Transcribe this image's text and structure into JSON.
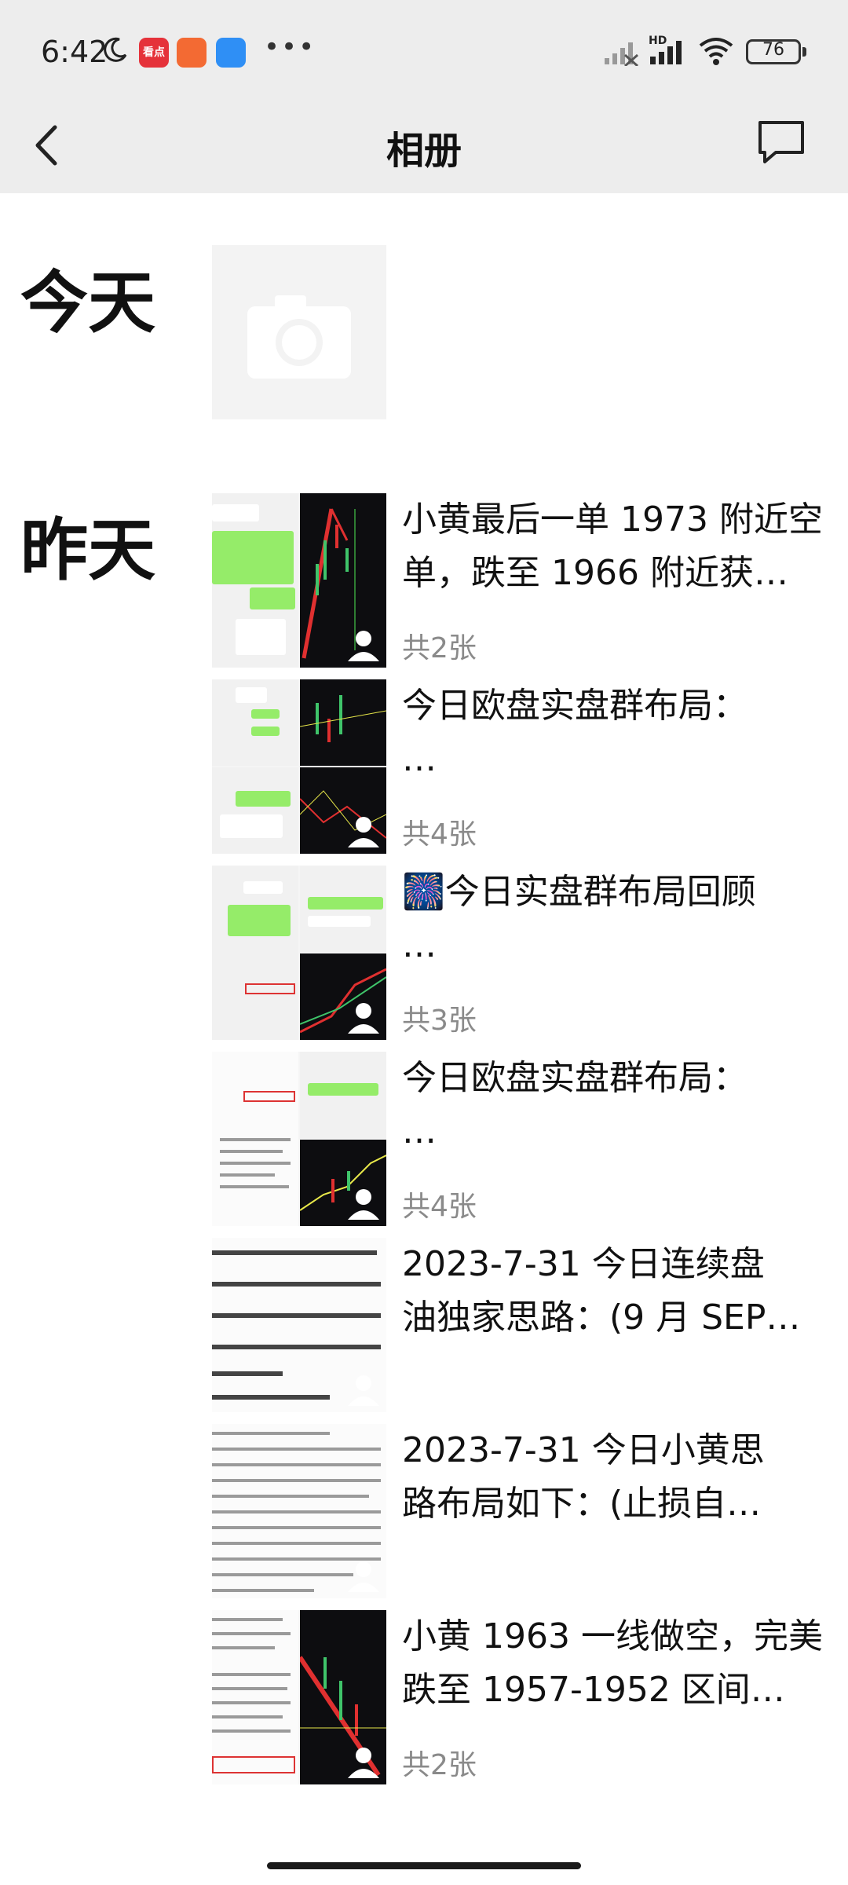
{
  "status_bar": {
    "time": "6:42",
    "battery": "76",
    "network": "HD",
    "app_badge_1": "看点"
  },
  "nav": {
    "title": "相册"
  },
  "sections": {
    "today": "今天",
    "yesterday": "昨天"
  },
  "albums": [
    {
      "line1": "小黄最后一单 1973 附近空",
      "line2": "单，跌至 1966 附近获…",
      "count": "共2张"
    },
    {
      "line1": "今日欧盘实盘群布局：",
      "line2": "…",
      "count": "共4张"
    },
    {
      "line1": "🎆今日实盘群布局回顾",
      "line2": "…",
      "count": "共3张"
    },
    {
      "line1": "今日欧盘实盘群布局：",
      "line2": "…",
      "count": "共4张"
    },
    {
      "line1": "2023-7-31  今日连续盘",
      "line2": "油独家思路：(9 月 SEP…",
      "count": ""
    },
    {
      "line1": "2023-7-31   今日小黄思",
      "line2": "路布局如下：(止损自…",
      "count": ""
    },
    {
      "line1": "小黄 1963 一线做空，完美",
      "line2": "跌至 1957-1952 区间…",
      "count": "共2张"
    }
  ],
  "colors": {
    "bar_bg": "#ededed",
    "chat_green": "#95ec69",
    "count_gray": "#8a8a8a"
  },
  "icons": [
    "moon-icon",
    "back-arrow-icon",
    "message-icon",
    "camera-icon",
    "person-icon",
    "signal-icon",
    "wifi-icon",
    "battery-icon"
  ]
}
